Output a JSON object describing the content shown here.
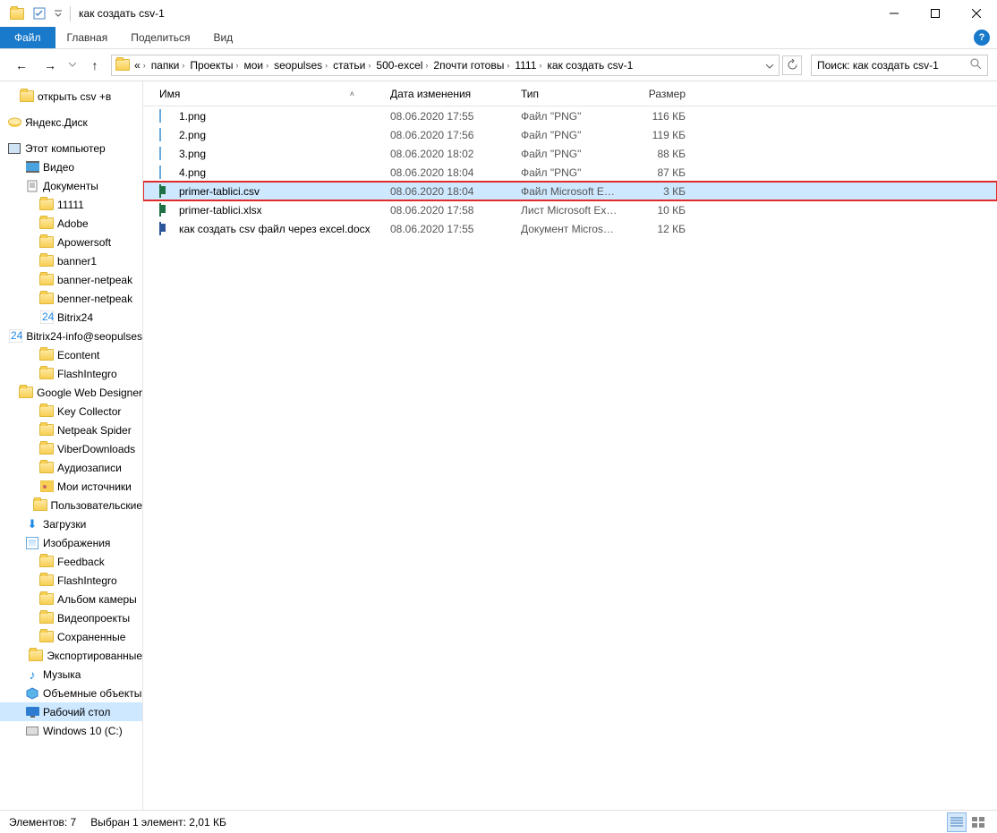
{
  "window": {
    "title": "как создать csv-1"
  },
  "ribbon": {
    "file": "Файл",
    "tabs": [
      "Главная",
      "Поделиться",
      "Вид"
    ]
  },
  "breadcrumb": {
    "leader": "«",
    "items": [
      "папки",
      "Проекты",
      "мои",
      "seopulses",
      "статьи",
      "500-excel",
      "2почти готовы",
      "1111",
      "как создать csv-1"
    ]
  },
  "search": {
    "placeholder": "Поиск: как создать csv-1"
  },
  "tree": [
    {
      "icon": "folder",
      "label": "открыть csv +в",
      "indent": 22
    },
    {
      "icon": "yadisk",
      "label": "Яндекс.Диск",
      "indent": 8,
      "gapBefore": 8
    },
    {
      "icon": "pc",
      "label": "Этот компьютер",
      "indent": 8,
      "gapBefore": 8
    },
    {
      "icon": "video",
      "label": "Видео",
      "indent": 28
    },
    {
      "icon": "docs",
      "label": "Документы",
      "indent": 28
    },
    {
      "icon": "folder",
      "label": "11111",
      "indent": 44
    },
    {
      "icon": "folder",
      "label": "Adobe",
      "indent": 44
    },
    {
      "icon": "folder",
      "label": "Apowersoft",
      "indent": 44
    },
    {
      "icon": "folder",
      "label": "banner1",
      "indent": 44
    },
    {
      "icon": "folder",
      "label": "banner-netpeak",
      "indent": 44
    },
    {
      "icon": "folder",
      "label": "benner-netpeak",
      "indent": 44
    },
    {
      "icon": "b24",
      "label": "Bitrix24",
      "indent": 44
    },
    {
      "icon": "b24",
      "label": "Bitrix24-info@seopulses",
      "indent": 44
    },
    {
      "icon": "folder",
      "label": "Econtent",
      "indent": 44
    },
    {
      "icon": "folder",
      "label": "FlashIntegro",
      "indent": 44
    },
    {
      "icon": "folder",
      "label": "Google Web Designer",
      "indent": 44
    },
    {
      "icon": "folder",
      "label": "Key Collector",
      "indent": 44
    },
    {
      "icon": "folder",
      "label": "Netpeak Spider",
      "indent": 44
    },
    {
      "icon": "folder",
      "label": "ViberDownloads",
      "indent": 44
    },
    {
      "icon": "folder",
      "label": "Аудиозаписи",
      "indent": 44
    },
    {
      "icon": "src",
      "label": "Мои источники",
      "indent": 44
    },
    {
      "icon": "folder",
      "label": "Пользовательские",
      "indent": 44
    },
    {
      "icon": "dl",
      "label": "Загрузки",
      "indent": 28
    },
    {
      "icon": "img",
      "label": "Изображения",
      "indent": 28
    },
    {
      "icon": "folder",
      "label": "Feedback",
      "indent": 44
    },
    {
      "icon": "folder",
      "label": "FlashIntegro",
      "indent": 44
    },
    {
      "icon": "folder",
      "label": "Альбом камеры",
      "indent": 44
    },
    {
      "icon": "folder",
      "label": "Видеопроекты",
      "indent": 44
    },
    {
      "icon": "folder",
      "label": "Сохраненные",
      "indent": 44
    },
    {
      "icon": "folder",
      "label": "Экспортированные",
      "indent": 44
    },
    {
      "icon": "music",
      "label": "Музыка",
      "indent": 28
    },
    {
      "icon": "3d",
      "label": "Объемные объекты",
      "indent": 28
    },
    {
      "icon": "desktop",
      "label": "Рабочий стол",
      "indent": 28,
      "selected": true
    },
    {
      "icon": "disk",
      "label": "Windows 10 (C:)",
      "indent": 28
    }
  ],
  "columns": {
    "name": "Имя",
    "date": "Дата изменения",
    "type": "Тип",
    "size": "Размер"
  },
  "files": [
    {
      "icon": "img",
      "name": "1.png",
      "date": "08.06.2020 17:55",
      "type": "Файл \"PNG\"",
      "size": "116 КБ"
    },
    {
      "icon": "img",
      "name": "2.png",
      "date": "08.06.2020 17:56",
      "type": "Файл \"PNG\"",
      "size": "119 КБ"
    },
    {
      "icon": "img",
      "name": "3.png",
      "date": "08.06.2020 18:02",
      "type": "Файл \"PNG\"",
      "size": "88 КБ"
    },
    {
      "icon": "img",
      "name": "4.png",
      "date": "08.06.2020 18:04",
      "type": "Файл \"PNG\"",
      "size": "87 КБ"
    },
    {
      "icon": "xls",
      "name": "primer-tablici.csv",
      "date": "08.06.2020 18:04",
      "type": "Файл Microsoft E…",
      "size": "3 КБ",
      "selected": true,
      "highlighted": true
    },
    {
      "icon": "xls",
      "name": "primer-tablici.xlsx",
      "date": "08.06.2020 17:58",
      "type": "Лист Microsoft Ex…",
      "size": "10 КБ"
    },
    {
      "icon": "doc",
      "name": "как создать csv файл через excel.docx",
      "date": "08.06.2020 17:55",
      "type": "Документ Micros…",
      "size": "12 КБ"
    }
  ],
  "status": {
    "count": "Элементов: 7",
    "selection": "Выбран 1 элемент: 2,01 КБ"
  }
}
